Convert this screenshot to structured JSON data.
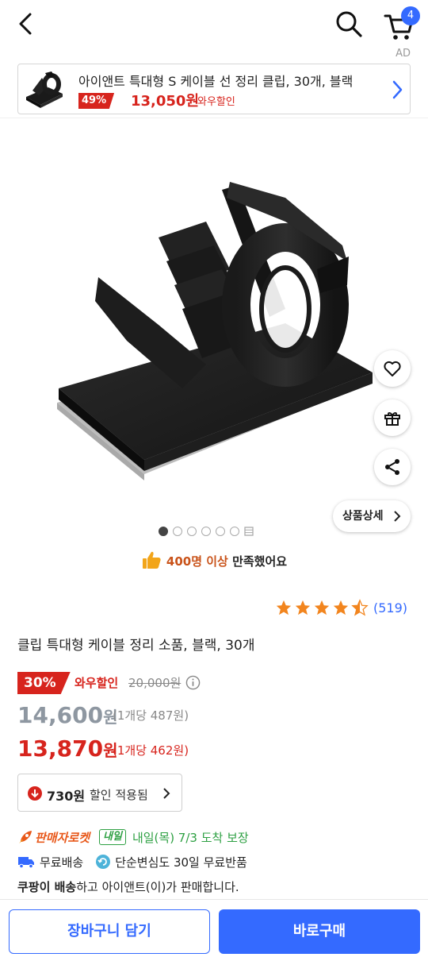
{
  "header": {
    "cart_count": "4",
    "ad_label": "AD"
  },
  "ad_banner": {
    "title": "아이앤트 특대형 S 케이블 선 정리 클립, 30개, 블랙",
    "discount": "49%",
    "price": "13,050원",
    "wow_label": "와우할인"
  },
  "gallery": {
    "image_count": 6,
    "active_index": 0,
    "detail_button": "상품상세"
  },
  "satisfaction": {
    "highlight": "400명 이상",
    "text": " 만족했어요"
  },
  "rating": {
    "stars": 4.5,
    "review_count": "(519)"
  },
  "product": {
    "title": "클립 특대형 케이블 정리 소품, 블랙, 30개",
    "discount_rate": "30%",
    "wow_label": "와우할인",
    "original_price": "20,000원",
    "sale_price_number": "14,600",
    "sale_price_unit": "원",
    "sale_unit_price": "(1개당 487원)",
    "wow_price_number": "13,870",
    "wow_price_unit": "원",
    "wow_unit_price": "(1개당 462원)"
  },
  "coupon": {
    "amount": "730원",
    "text": "할인 적용됨"
  },
  "delivery": {
    "rocket_label": "판매자로켓",
    "tomorrow_badge": "내일",
    "date_text": "내일(목) 7/3 도착 보장",
    "free_shipping": "무료배송",
    "free_return": "단순변심도 30일 무료반품"
  },
  "seller": {
    "bold": "쿠팡이 배송",
    "rest": "하고 아이앤트(이)가 판매합니다."
  },
  "actions": {
    "add_to_cart": "장바구니 담기",
    "buy_now": "바로구매"
  },
  "colors": {
    "accent": "#346aff",
    "discount": "#d7241d",
    "rocket": "#e8581a",
    "delivery_green": "#2ea043"
  }
}
